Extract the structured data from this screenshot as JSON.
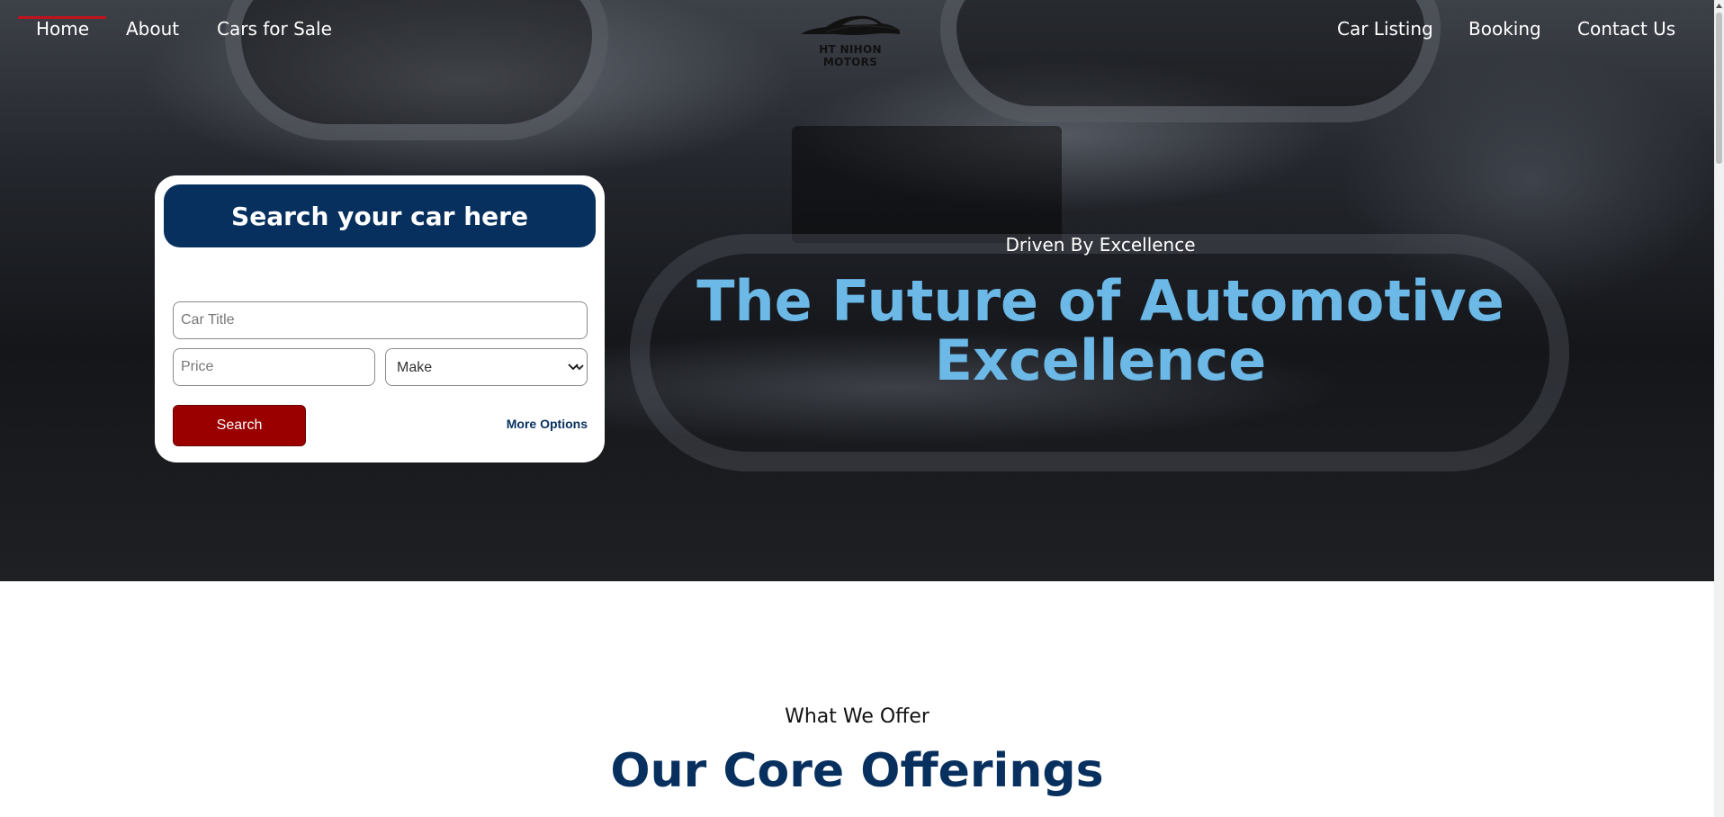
{
  "nav": {
    "left": [
      "Home",
      "About",
      "Cars for Sale"
    ],
    "right": [
      "Car Listing",
      "Booking",
      "Contact Us"
    ],
    "active": "Home"
  },
  "logo": {
    "text": "HT NIHON MOTORS",
    "icon": "car-silhouette-icon"
  },
  "search": {
    "heading": "Search your car here",
    "car_title_placeholder": "Car Title",
    "price_placeholder": "Price",
    "make_selected": "Make",
    "search_label": "Search",
    "more_options_label": "More Options"
  },
  "hero": {
    "kicker": "Driven By Excellence",
    "title": "The Future of Automotive Excellence"
  },
  "offerings": {
    "kicker": "What We Offer",
    "title": "Our Core Offerings"
  },
  "colors": {
    "brand_navy": "#08305f",
    "accent_blue": "#6cb8e6",
    "search_red": "#9b0000",
    "active_underline": "#c1121f"
  }
}
